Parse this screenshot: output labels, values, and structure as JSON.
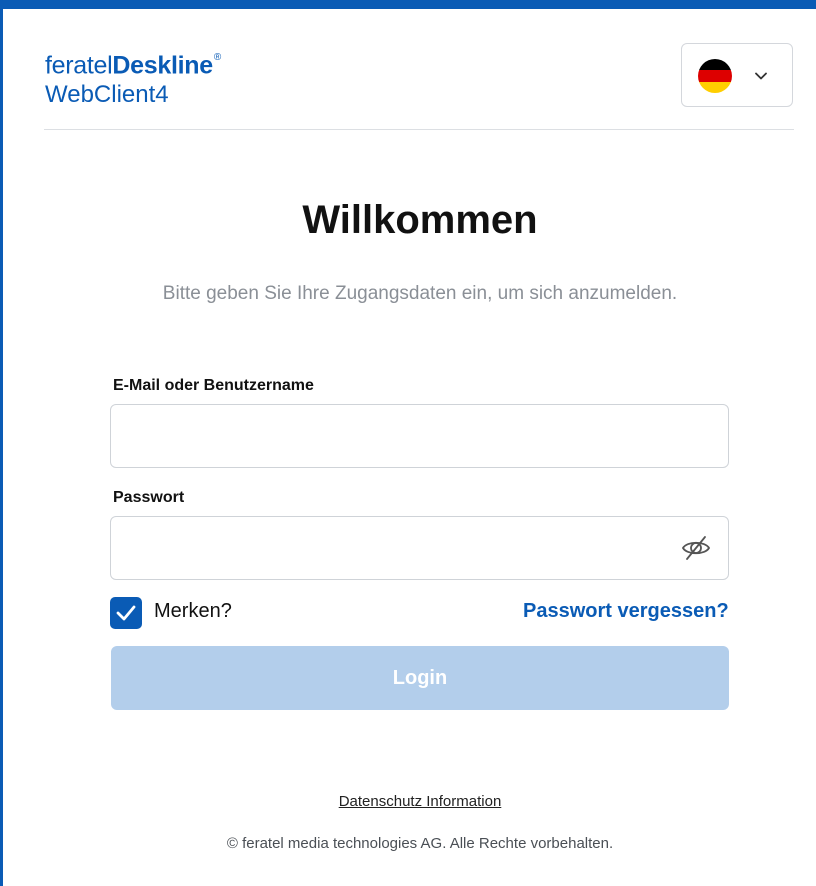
{
  "header": {
    "logo_prefix": "feratel",
    "logo_brand": "Deskline",
    "logo_mark": "®",
    "logo_product": "WebClient4",
    "language": {
      "selected_flag": "germany-flag-icon"
    }
  },
  "main": {
    "title": "Willkommen",
    "subtitle": "Bitte geben Sie Ihre Zugangsdaten ein, um sich anzumelden.",
    "username": {
      "label": "E-Mail oder Benutzername",
      "value": "",
      "placeholder": ""
    },
    "password": {
      "label": "Passwort",
      "value": "",
      "placeholder": ""
    },
    "remember": {
      "label": "Merken?",
      "checked": true
    },
    "forgot_link": "Passwort vergessen?",
    "login_label": "Login"
  },
  "footer": {
    "privacy_link": "Datenschutz Information",
    "copyright": "© feratel media technologies AG. Alle Rechte vorbehalten."
  },
  "colors": {
    "accent": "#0a5bb5",
    "button_disabled": "#b3ceeb",
    "muted_text": "#8a8f96",
    "flag_black": "#000000",
    "flag_red": "#dd0000",
    "flag_gold": "#ffce00"
  }
}
